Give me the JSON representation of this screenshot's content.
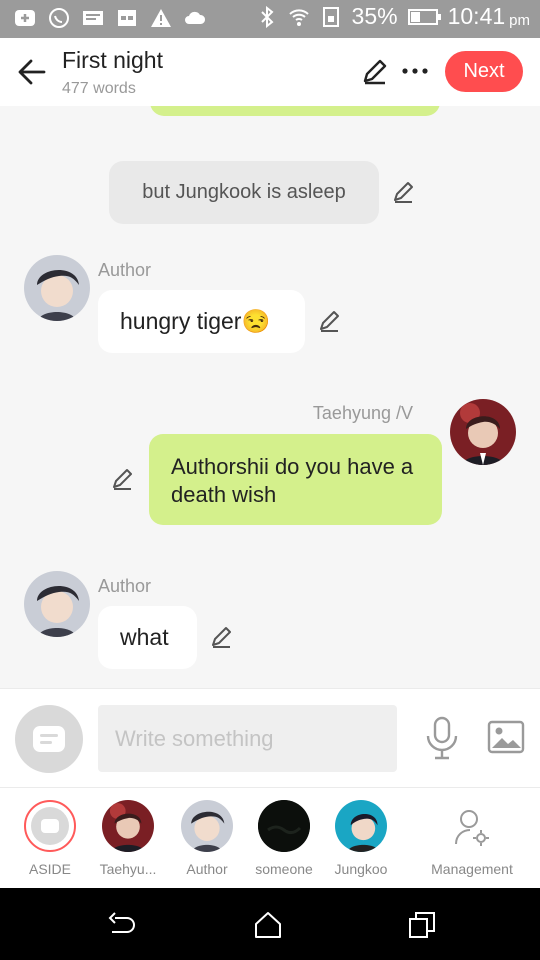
{
  "status_bar": {
    "battery": "35%",
    "time": "10:41",
    "ampm": "pm",
    "icons": [
      "add-icon",
      "whatsapp-icon",
      "message-icon",
      "calendar-icon",
      "warning-icon",
      "cloud-icon",
      "bluetooth-icon",
      "wifi-icon",
      "sim-icon",
      "battery-icon"
    ]
  },
  "header": {
    "title": "First night",
    "word_count": "477 words",
    "next_label": "Next"
  },
  "chat": {
    "aside_text": "but Jungkook is asleep",
    "messages": [
      {
        "sender": "Author",
        "text": "hungry tiger😒",
        "side": "left"
      },
      {
        "sender": "Taehyung /V",
        "text": "Authorshii do you have a death wish",
        "side": "right"
      },
      {
        "sender": "Author",
        "text": "what",
        "side": "left"
      }
    ]
  },
  "input": {
    "placeholder": "Write something"
  },
  "characters": [
    {
      "label": "ASIDE"
    },
    {
      "label": "Taehyu..."
    },
    {
      "label": "Author"
    },
    {
      "label": "someone"
    },
    {
      "label": "Jungkoo"
    }
  ],
  "management_label": "Management",
  "colors": {
    "accent": "#ff4d4f",
    "green_bubble": "#d4f08c",
    "status_bar": "#9b9b9b"
  }
}
